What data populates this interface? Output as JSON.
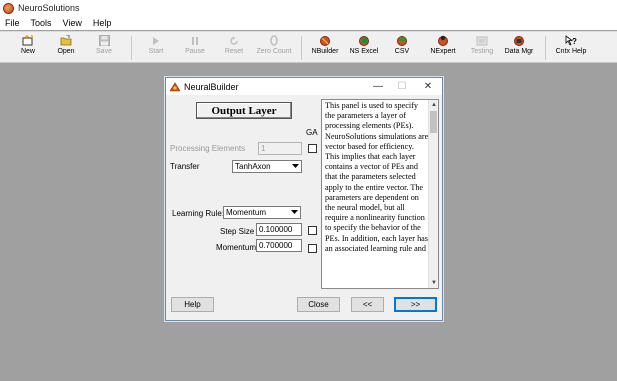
{
  "app": {
    "title": "NeuroSolutions"
  },
  "menu": [
    "File",
    "Tools",
    "View",
    "Help"
  ],
  "toolbar": {
    "new": "New",
    "open": "Open",
    "save": "Save",
    "start": "Start",
    "pause": "Pause",
    "reset": "Reset",
    "zero_count": "Zero Count",
    "nbuilder": "NBuilder",
    "ns_excel": "NS Excel",
    "csv": "CSV",
    "nexpert": "NExpert",
    "testing": "Testing",
    "data_mgr": "Data Mgr",
    "cntx_help": "Cntx Help"
  },
  "dialog": {
    "title": "NeuralBuilder",
    "minimize": "—",
    "maximize": "☐",
    "close": "✕",
    "layer_title": "Output Layer",
    "ga_label": "GA",
    "processing_elements_label": "Processing Elements",
    "processing_elements_value": "1",
    "transfer_label": "Transfer",
    "transfer_value": "TanhAxon",
    "learning_rule_label": "Learning Rule:",
    "learning_rule_value": "Momentum",
    "step_size_label": "Step Size",
    "step_size_value": "0.100000",
    "momentum_label": "Momentum",
    "momentum_value": "0.700000",
    "help_text": "This panel is used to specify the parameters a layer of processing elements (PEs). NeuroSolutions simulations are vector based for efficiency. This implies that each layer contains a vector of PEs and that the parameters selected apply to the entire vector. The parameters are dependent on the neural model, but all require a nonlinearity function to specify the behavior of the PEs. In addition, each layer has an associated learning rule and",
    "buttons": {
      "help": "Help",
      "close": "Close",
      "back": "<<",
      "next": ">>"
    }
  },
  "colors": {
    "workspace": "#a0a0a0",
    "accent": "#0078d7"
  }
}
